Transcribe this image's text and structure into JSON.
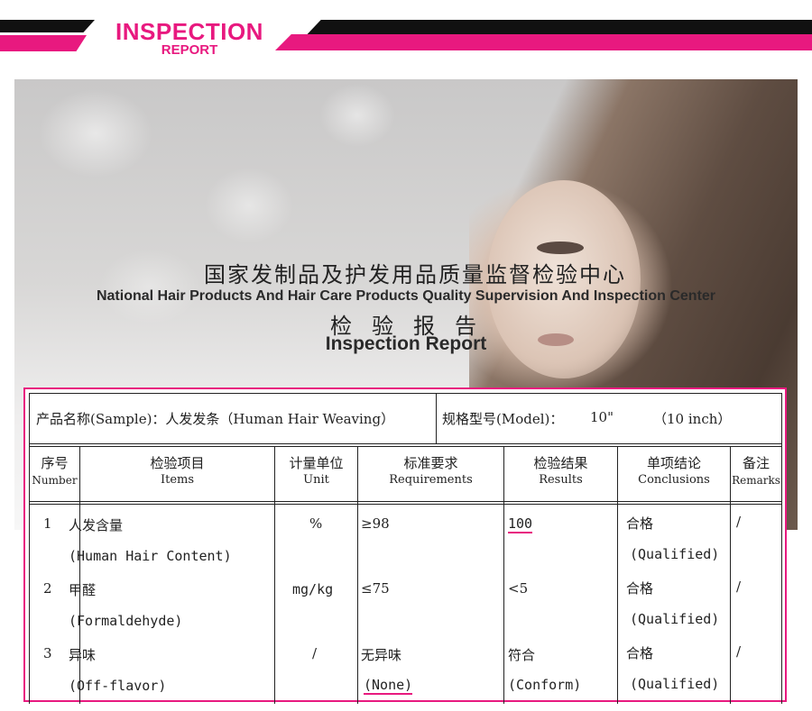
{
  "banner": {
    "title": "INSPECTION",
    "subtitle": "REPORT"
  },
  "center": {
    "name_cn": "国家发制品及护发用品质量监督检验中心",
    "name_en": "National Hair Products And Hair Care Products Quality Supervision And Inspection Center",
    "report_cn": "检验报告",
    "report_en": "Inspection Report"
  },
  "table": {
    "sample": "产品名称(Sample)：人发发条（Human Hair Weaving）",
    "model_label": "规格型号(Model)：",
    "model_value": "10\"",
    "model_inch": "（10 inch）",
    "headers": [
      {
        "cn": "序号",
        "en": "Number"
      },
      {
        "cn": "检验项目",
        "en": "Items"
      },
      {
        "cn": "计量单位",
        "en": "Unit"
      },
      {
        "cn": "标准要求",
        "en": "Requirements"
      },
      {
        "cn": "检验结果",
        "en": "Results"
      },
      {
        "cn": "单项结论",
        "en": "Conclusions"
      },
      {
        "cn": "备注",
        "en": "Remarks"
      }
    ],
    "rows": [
      {
        "num": "1",
        "item_cn": "人发含量",
        "item_en": "(Human Hair Content)",
        "unit": "%",
        "req": "≥98",
        "req_en": "",
        "result": "100",
        "result_en": "",
        "concl_cn": "合格",
        "concl_en": "(Qualified)",
        "remark": "/"
      },
      {
        "num": "2",
        "item_cn": "甲醛",
        "item_en": "(Formaldehyde)",
        "unit": "mg/kg",
        "req": "≤75",
        "req_en": "",
        "result": "<5",
        "result_en": "",
        "concl_cn": "合格",
        "concl_en": "(Qualified)",
        "remark": "/"
      },
      {
        "num": "3",
        "item_cn": "异味",
        "item_en": "(Off-flavor)",
        "unit": "/",
        "req": "无异味",
        "req_en": "(None)",
        "result": "符合",
        "result_en": "(Conform)",
        "concl_cn": "合格",
        "concl_en": "(Qualified)",
        "remark": "/"
      }
    ]
  },
  "colors": {
    "accent": "#e8197f",
    "dark": "#111111"
  }
}
